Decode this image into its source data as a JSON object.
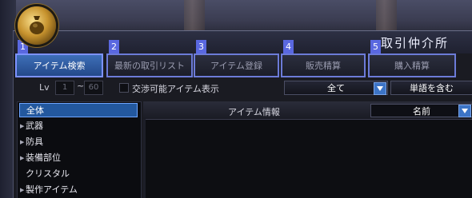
{
  "window": {
    "title": "取引仲介所"
  },
  "tabs": [
    {
      "num": "1",
      "label": "アイテム検索",
      "active": true
    },
    {
      "num": "2",
      "label": "最新の取引リスト",
      "active": false
    },
    {
      "num": "3",
      "label": "アイテム登録",
      "active": false
    },
    {
      "num": "4",
      "label": "販売精算",
      "active": false
    },
    {
      "num": "5",
      "label": "購入精算",
      "active": false
    }
  ],
  "filters": {
    "lv_label": "Lv",
    "lv_min": "1",
    "range_sep": "~",
    "lv_max": "60",
    "tradable_label": "交渉可能アイテム表示",
    "tradable_checked": false,
    "category_dropdown": "全て",
    "match_dropdown": "単語を含む"
  },
  "sidebar": {
    "items": [
      {
        "label": "全体",
        "selected": true,
        "expandable": false
      },
      {
        "label": "武器",
        "selected": false,
        "expandable": true
      },
      {
        "label": "防具",
        "selected": false,
        "expandable": true
      },
      {
        "label": "装備部位",
        "selected": false,
        "expandable": true
      },
      {
        "label": "クリスタル",
        "selected": false,
        "expandable": false
      },
      {
        "label": "製作アイテム",
        "selected": false,
        "expandable": true
      }
    ]
  },
  "item_list": {
    "header": "アイテム情報",
    "sort_value": "名前"
  },
  "icons": {
    "emblem": "money-bag-icon",
    "expand": "expand-triangle-icon",
    "dropdown": "chevron-down-icon"
  },
  "colors": {
    "accent": "#6c7bd8",
    "active_tab": "#3e6fb8",
    "selected_row": "#23589e"
  }
}
